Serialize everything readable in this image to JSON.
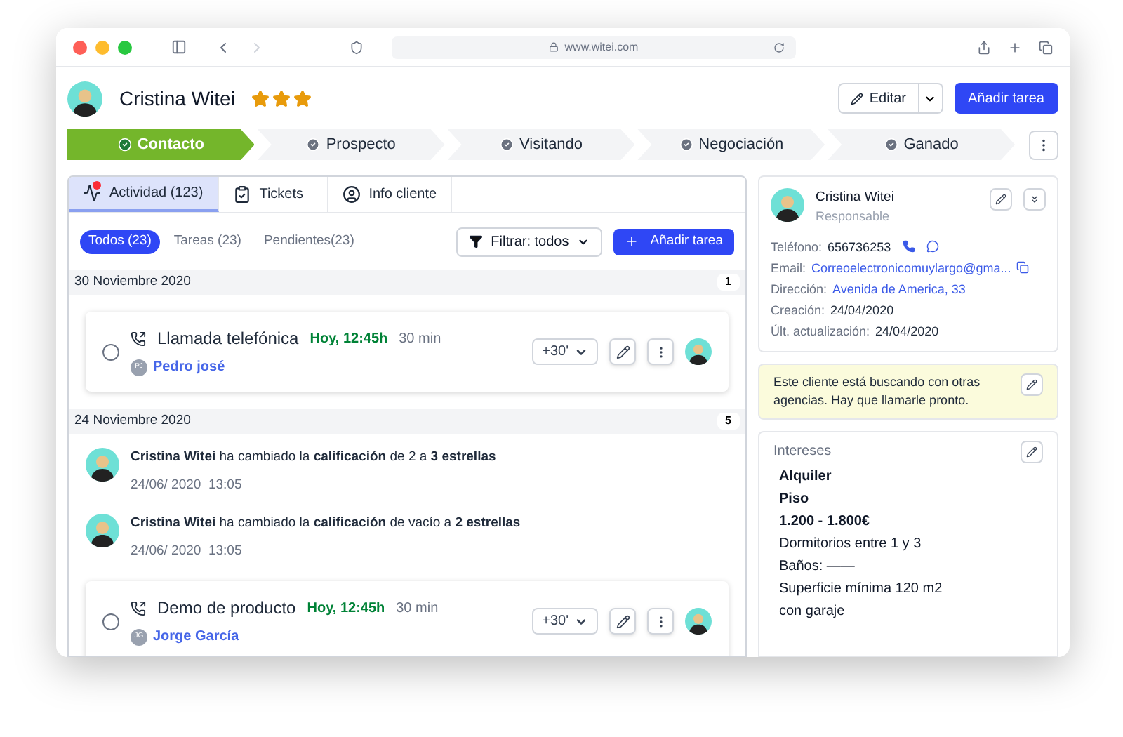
{
  "browser": {
    "url": "www.witei.com"
  },
  "header": {
    "name": "Cristina Witei",
    "stars": 3,
    "edit_button": "Editar",
    "add_task_button": "Añadir tarea"
  },
  "pipeline": [
    {
      "label": "Contacto",
      "selected": true
    },
    {
      "label": "Prospecto",
      "selected": false
    },
    {
      "label": "Visitando",
      "selected": false
    },
    {
      "label": "Negociación",
      "selected": false
    },
    {
      "label": "Ganado",
      "selected": false
    }
  ],
  "tabs": [
    {
      "label": "Actividad (123)",
      "selected": true,
      "kind": "activity"
    },
    {
      "label": "Tickets",
      "selected": false,
      "kind": "tickets"
    },
    {
      "label": "Info cliente",
      "selected": false,
      "kind": "client"
    }
  ],
  "filters": [
    {
      "label": "Todos (23)",
      "selected": true
    },
    {
      "label": "Tareas (23)",
      "selected": false
    },
    {
      "label": "Pendientes(23)",
      "selected": false
    }
  ],
  "filter_dropdown": "Filtrar: todos",
  "add_task_button": "Añadir tarea",
  "groups": [
    {
      "date": "30 Noviembre 2020",
      "count": "1",
      "items": [
        {
          "kind": "task",
          "title": "Llamada telefónica",
          "time": "Hoy, 12:45h",
          "duration": "30 min",
          "initials": "PJ",
          "assignee": "Pedro josé",
          "snooze": "+30'",
          "checked": false
        }
      ]
    },
    {
      "date": "24 Noviembre 2020",
      "count": "5",
      "items": [
        {
          "kind": "event",
          "text": "**Cristina Witei** ha cambiado la **calificación** de 2  a **3 estrellas**",
          "date": "24/06/ 2020  13:05"
        },
        {
          "kind": "event",
          "text": "**Cristina Witei** ha cambiado la **calificación** de vacío a **2 estrellas**",
          "date": "24/06/ 2020  13:05"
        },
        {
          "kind": "task",
          "title": "Demo de producto",
          "time": "Hoy, 12:45h",
          "duration": "30 min",
          "initials": "JG",
          "assignee": "Jorge García",
          "snooze": "+30'",
          "checked": false
        }
      ]
    }
  ],
  "contact_card": {
    "name": "Cristina Witei",
    "role": "Responsable",
    "fields": [
      {
        "label": "Teléfono:",
        "value": "656736253",
        "kind": "phone"
      },
      {
        "label": "Email:",
        "value": "Correoelectronicomuylargo@gma...",
        "kind": "email"
      },
      {
        "label": "Dirección:",
        "value": "Avenida de America, 33",
        "kind": "link"
      },
      {
        "label": "Creación:",
        "value": "24/04/2020",
        "kind": "plain"
      },
      {
        "label": "Últ. actualización:",
        "value": "24/04/2020",
        "kind": "plain"
      }
    ]
  },
  "note": "Este cliente está buscando con otras agencias. Hay que llamarle pronto.",
  "interests": {
    "title": "Intereses",
    "items": [
      {
        "text": "Alquiler",
        "bold": true
      },
      {
        "text": "Piso",
        "bold": true
      },
      {
        "text": "1.200 - 1.800€",
        "bold": true
      },
      {
        "text": "Dormitorios entre 1 y 3",
        "bold": false
      },
      {
        "text": "Baños: ——",
        "bold": false
      },
      {
        "text": "Superficie mínima 120 m2",
        "bold": false
      },
      {
        "text": "con garaje",
        "bold": false
      }
    ]
  }
}
